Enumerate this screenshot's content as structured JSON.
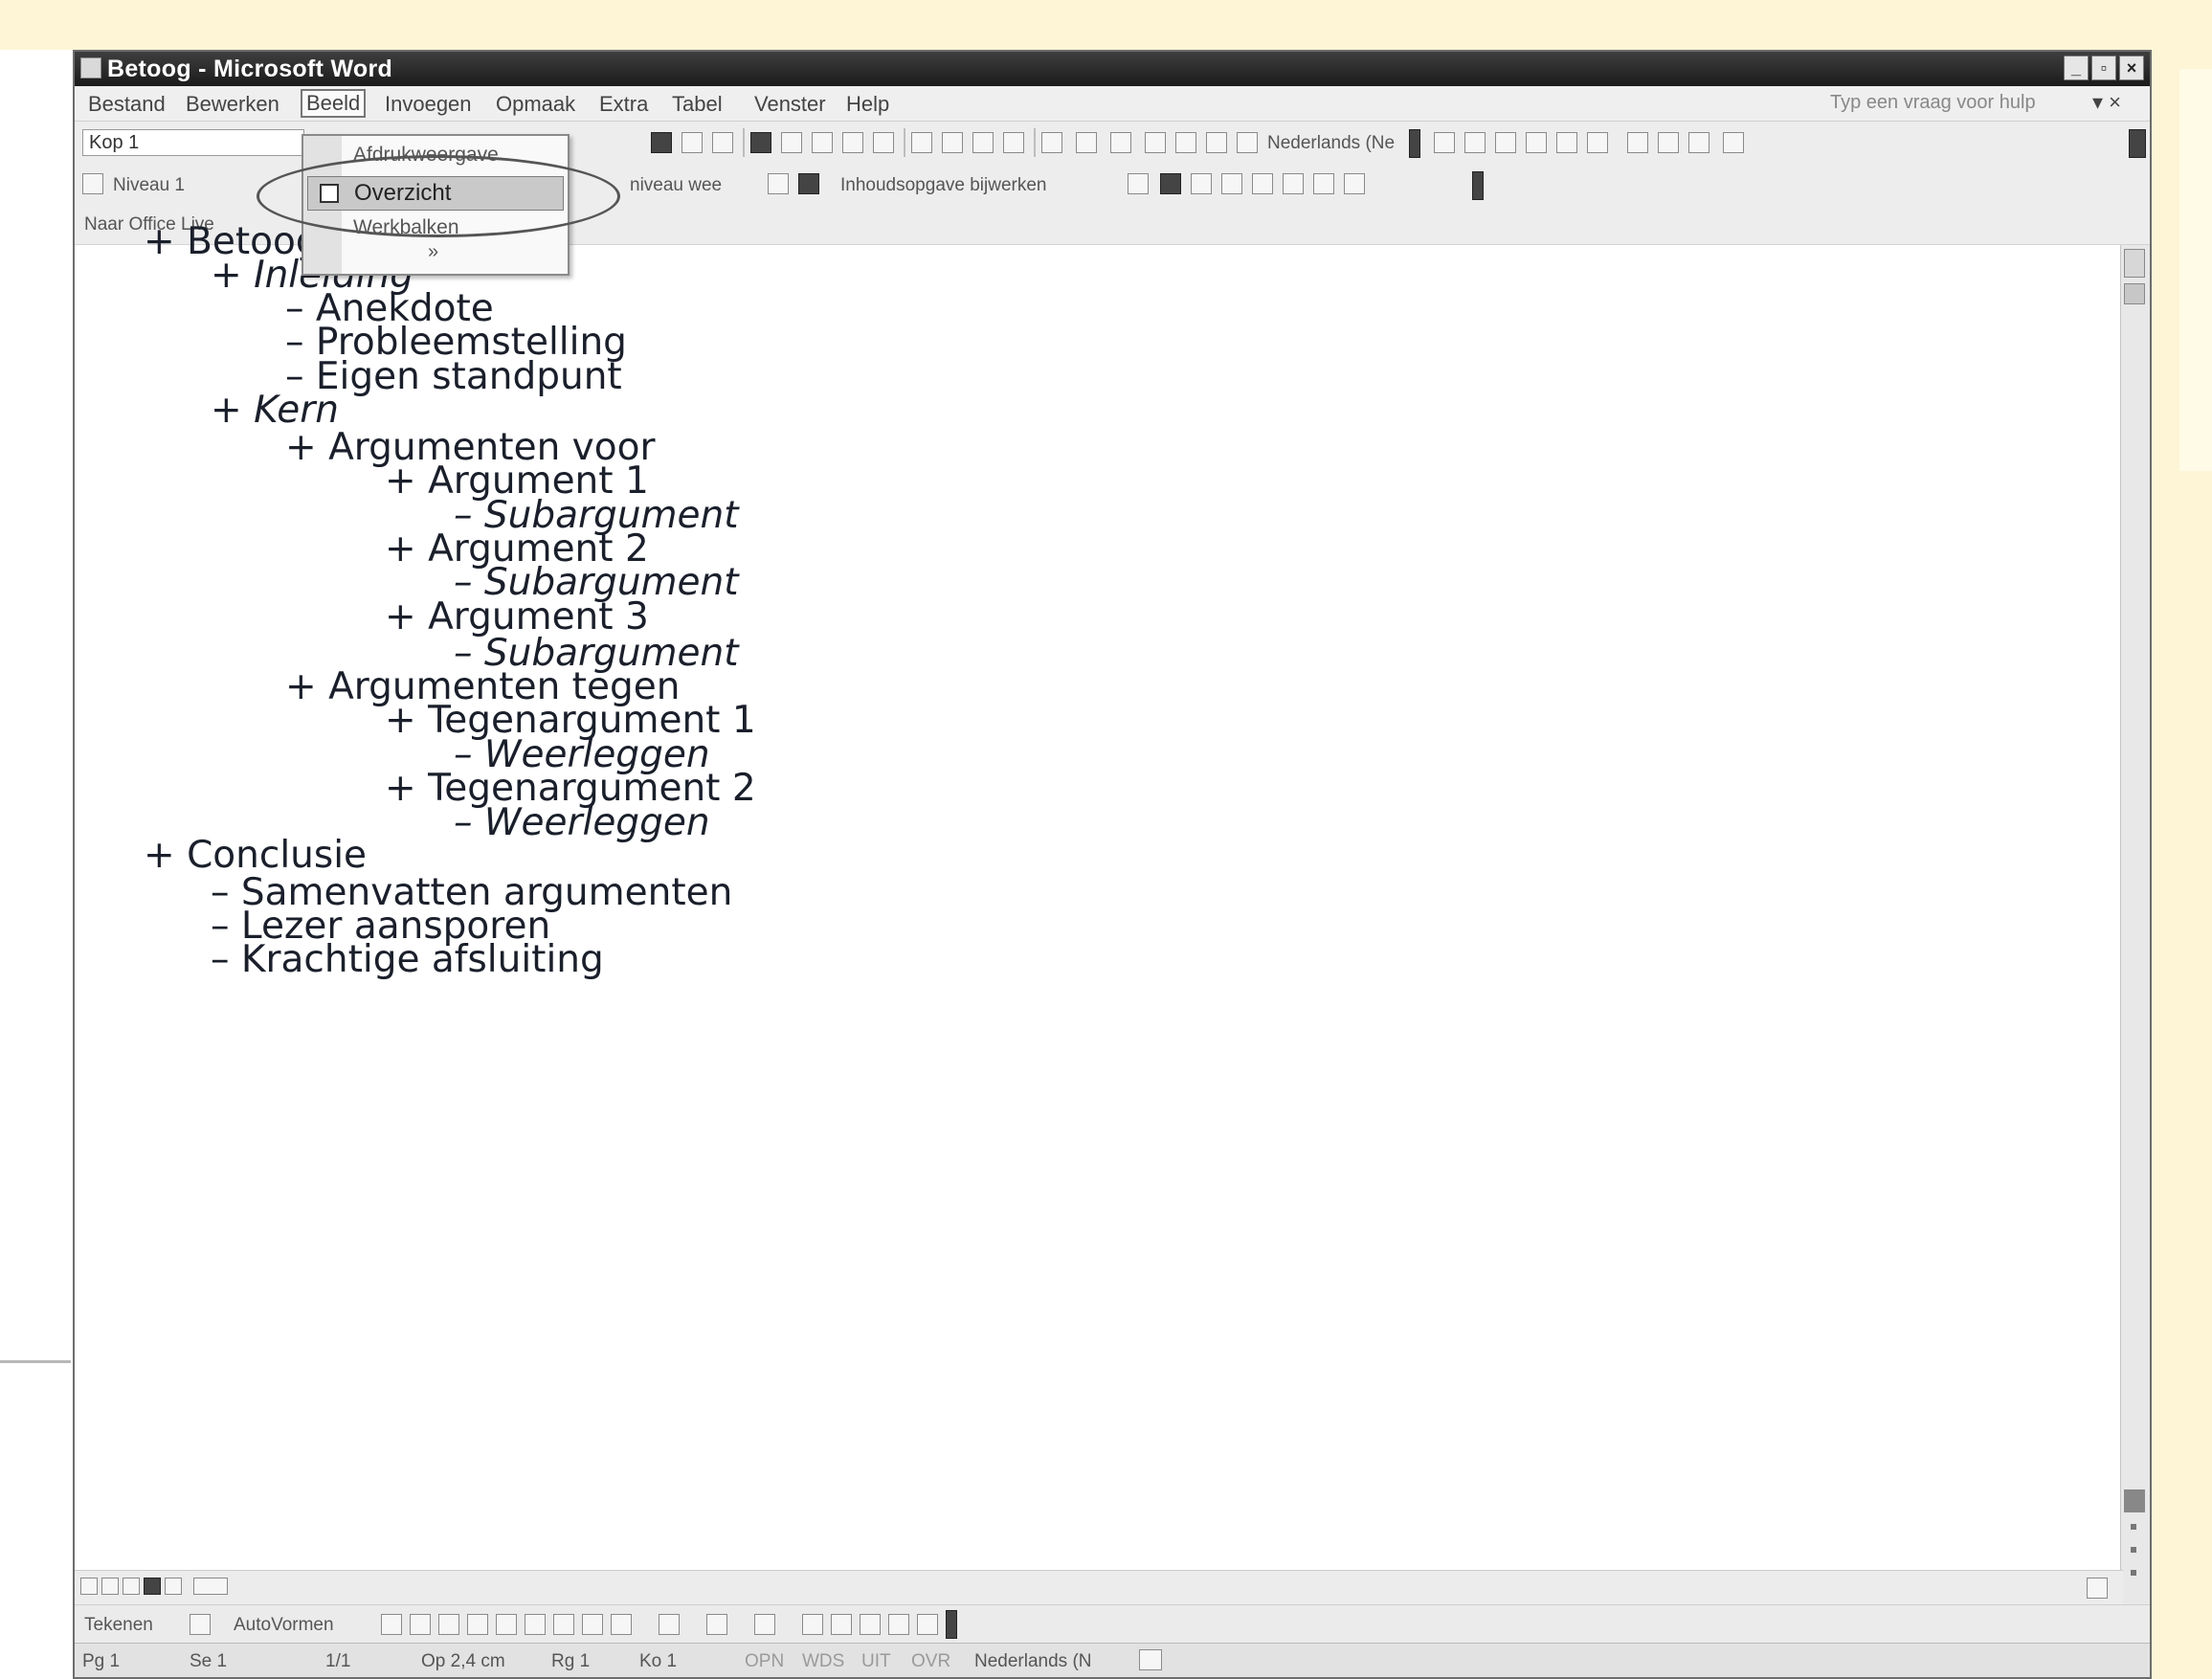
{
  "window": {
    "title": "Betoog - Microsoft Word"
  },
  "menu": [
    "Bestand",
    "Bewerken",
    "Beeld",
    "Invoegen",
    "Opmaak",
    "Extra",
    "Tabel",
    "Venster",
    "Help"
  ],
  "help_box": "Typ een vraag voor hulp",
  "toolbar1": {
    "style": "Kop 1",
    "language": "Nederlands (Ne"
  },
  "toolbar2": {
    "level": "Niveau 1",
    "show_level": "niveau wee",
    "toc_update": "Inhoudsopgave bijwerken"
  },
  "toolbar3": {
    "office_live": "Naar Office Live"
  },
  "dropdown": {
    "item1": "Afdrukweergave",
    "selected": "Overzicht",
    "item3": "Werkbalken",
    "more": "»"
  },
  "outline": [
    {
      "text": "+ Betoog",
      "italic": false
    },
    {
      "text": "+ Inleiding",
      "italic": true
    },
    {
      "text": "– Anekdote",
      "italic": false
    },
    {
      "text": "– Probleemstelling",
      "italic": false
    },
    {
      "text": "– Eigen standpunt",
      "italic": false
    },
    {
      "text": "+ Kern",
      "italic": true
    },
    {
      "text": "+ Argumenten voor",
      "italic": false
    },
    {
      "text": "+ Argument 1",
      "italic": false
    },
    {
      "text": "– Subargument",
      "italic": true
    },
    {
      "text": "+ Argument 2",
      "italic": false
    },
    {
      "text": "– Subargument",
      "italic": true
    },
    {
      "text": "+ Argument 3",
      "italic": false
    },
    {
      "text": "– Subargument",
      "italic": true
    },
    {
      "text": "+ Argumenten tegen",
      "italic": false
    },
    {
      "text": "+ Tegenargument 1",
      "italic": false
    },
    {
      "text": "– Weerleggen",
      "italic": true
    },
    {
      "text": "+ Tegenargument 2",
      "italic": false
    },
    {
      "text": "– Weerleggen",
      "italic": true
    },
    {
      "text": "+ Conclusie",
      "italic": false
    },
    {
      "text": "– Samenvatten argumenten",
      "italic": false
    },
    {
      "text": "– Lezer aansporen",
      "italic": false
    },
    {
      "text": "– Krachtige afsluiting",
      "italic": false
    }
  ],
  "drawbar": {
    "draw": "Tekenen",
    "autoshapes": "AutoVormen"
  },
  "status": {
    "page": "Pg 1",
    "section": "Se 1",
    "pages": "1/1",
    "at": "Op 2,4 cm",
    "line": "Rg 1",
    "col": "Ko 1",
    "rec": "OPN",
    "trk": "WDS",
    "ext": "UIT",
    "ovr": "OVR",
    "language": "Nederlands (N"
  }
}
